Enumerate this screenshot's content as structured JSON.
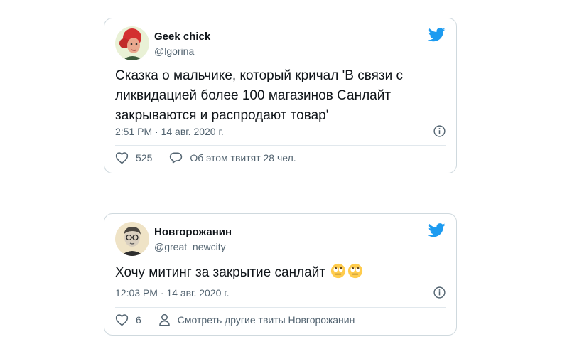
{
  "colors": {
    "twitter_blue": "#1d9bf0",
    "muted": "#536471",
    "border": "#cfd9de"
  },
  "tweets": [
    {
      "name": "Geek chick",
      "handle": "@lgorina",
      "text_lines": [
        "Сказка о мальчике, который кричал 'В связи с",
        "ликвидацией более 100 магазинов Санлайт",
        "закрываются и распродают товар'"
      ],
      "time": "2:51 PM · 14 авг. 2020 г.",
      "likes": "525",
      "reply_label": "Об этом твитят 28 чел.",
      "icons": {
        "brand": "twitter-bird-icon",
        "like": "heart-icon",
        "reply": "speech-bubble-icon",
        "info": "info-icon"
      }
    },
    {
      "name": "Новгорожанин",
      "handle": "@great_newcity",
      "text": "Хочу митинг за закрытие санлайт",
      "emoji": [
        "rolling-eyes-emoji",
        "rolling-eyes-emoji"
      ],
      "time": "12:03 PM · 14 авг. 2020 г.",
      "likes": "6",
      "profile_label": "Смотреть другие твиты Новгорожанин",
      "icons": {
        "brand": "twitter-bird-icon",
        "like": "heart-icon",
        "profile": "person-icon",
        "info": "info-icon"
      }
    }
  ]
}
